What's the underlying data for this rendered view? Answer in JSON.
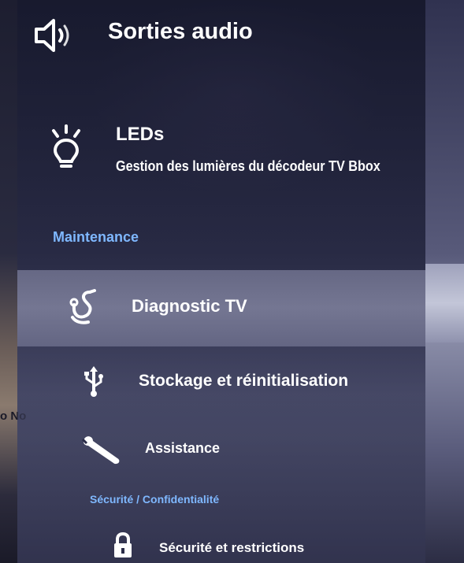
{
  "menu": {
    "audio": {
      "label": "Sorties audio",
      "icon": "speaker-icon"
    },
    "leds": {
      "label": "LEDs",
      "sublabel": "Gestion des lumières du décodeur TV Bbox",
      "icon": "light-bulb-icon"
    },
    "maintenance_section": "Maintenance",
    "diagnostic": {
      "label": "Diagnostic TV",
      "icon": "stethoscope-icon"
    },
    "storage": {
      "label": "Stockage et réinitialisation",
      "icon": "usb-icon"
    },
    "assistance": {
      "label": "Assistance",
      "icon": "wrench-icon"
    },
    "security_section": "Sécurité / Confidentialité",
    "security": {
      "label": "Sécurité et restrictions",
      "icon": "lock-icon"
    }
  },
  "background": {
    "left_text": "o No"
  },
  "colors": {
    "section_label": "#7fb8ff",
    "text": "#ffffff",
    "highlight": "#a0a2be"
  }
}
